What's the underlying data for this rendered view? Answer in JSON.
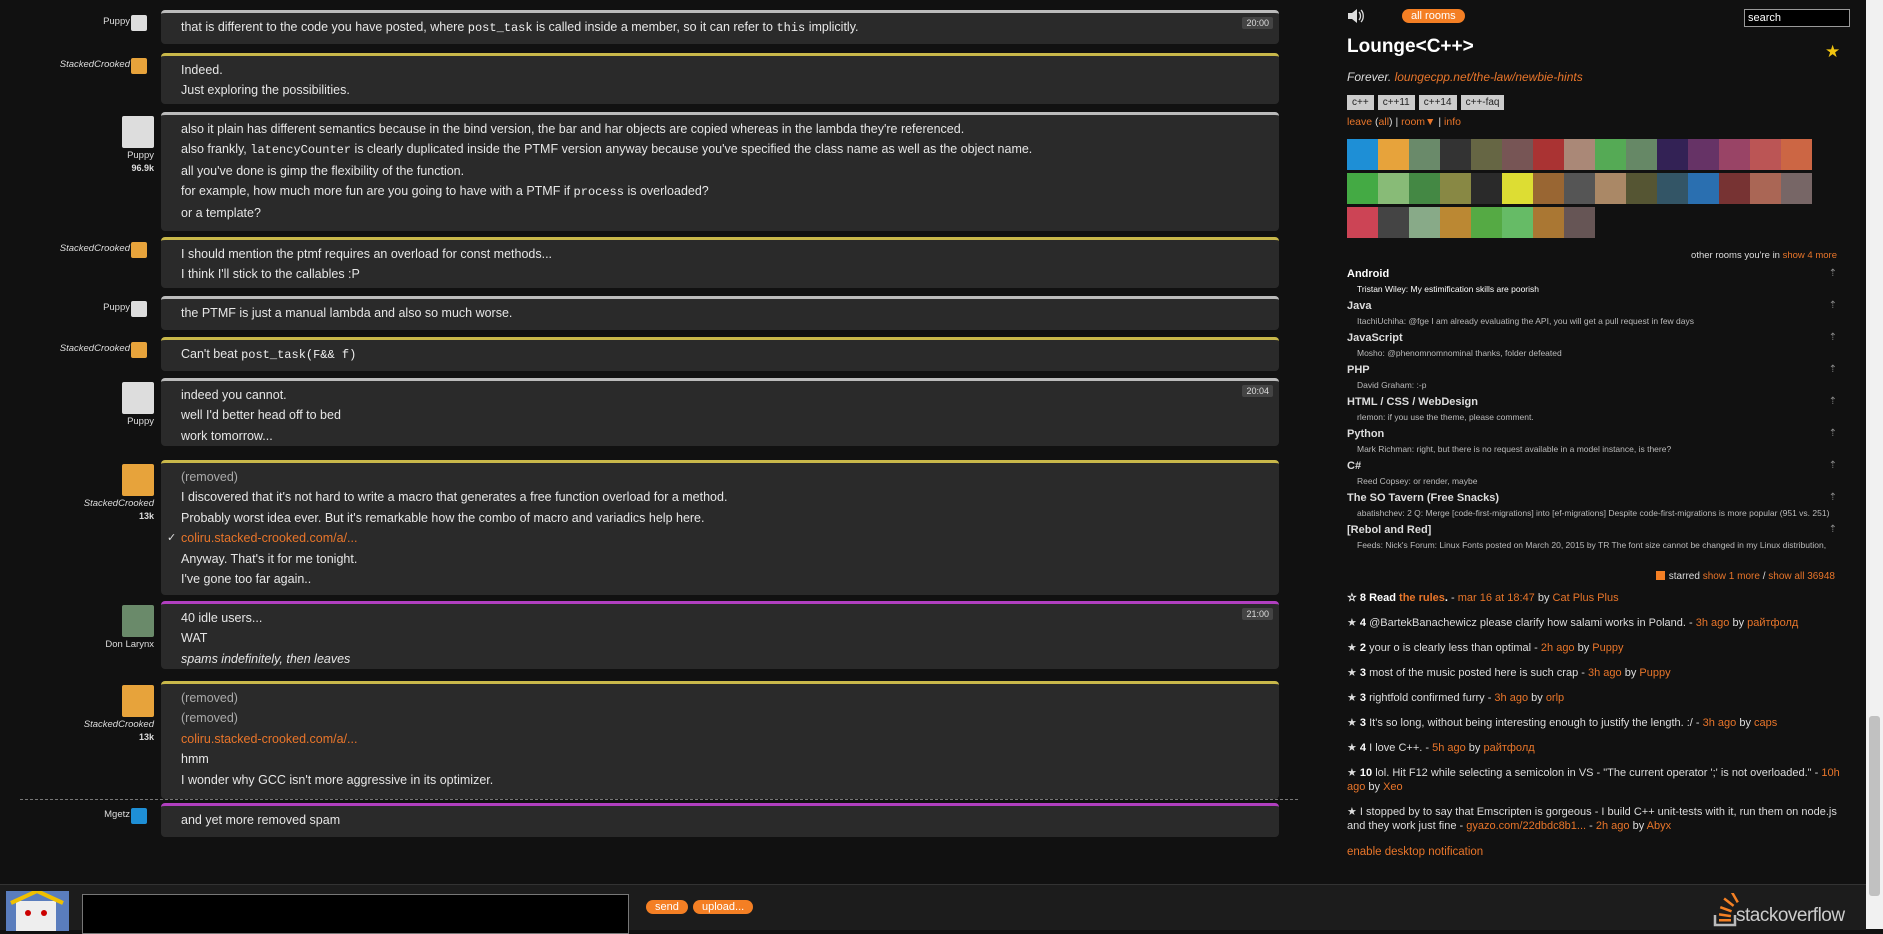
{
  "messages": [
    {
      "user": "Puppy",
      "avatar_color": "#ddd",
      "style": "small",
      "border": "w",
      "lines": [
        {
          "html": "that is different to the code you have posted, where <code>post_task</code> is called inside a member, so it can refer to <code>this</code> implicitly."
        }
      ],
      "time": "20:00"
    },
    {
      "user": "StackedCrooked",
      "avatar_color": "#e7a33b",
      "style": "small",
      "italic": true,
      "border": "y",
      "lines": [
        {
          "text": "Indeed."
        },
        {
          "text": "Just exploring the possibilities."
        }
      ]
    },
    {
      "user": "Puppy",
      "rep": "96.9k",
      "avatar_color": "#ddd",
      "style": "big",
      "border": "w",
      "lines": [
        {
          "text": "also it plain has different semantics because in the bind version, the bar and har objects are copied whereas in the lambda they're referenced."
        },
        {
          "html": "also frankly, <code>latencyCounter</code> is clearly duplicated inside the PTMF version anyway because you've specified the class name as well as the object name."
        },
        {
          "text": "all you've done is gimp the flexibility of the function."
        },
        {
          "html": "for example, how much more fun are you going to have with a PTMF if <code>process</code> is overloaded?"
        },
        {
          "text": "or a template?"
        }
      ]
    },
    {
      "user": "StackedCrooked",
      "avatar_color": "#e7a33b",
      "style": "small",
      "italic": true,
      "border": "y",
      "lines": [
        {
          "text": "I should mention the ptmf requires an overload for const methods..."
        },
        {
          "text": "I think I'll stick to the callables :P"
        }
      ]
    },
    {
      "user": "Puppy",
      "avatar_color": "#ddd",
      "style": "small",
      "border": "w",
      "lines": [
        {
          "text": "the PTMF is just a manual lambda and also so much worse."
        }
      ]
    },
    {
      "user": "StackedCrooked",
      "avatar_color": "#e7a33b",
      "style": "small",
      "italic": true,
      "border": "y",
      "lines": [
        {
          "html": "Can't beat <code>post_task(F&amp;&amp; f)</code>"
        }
      ]
    },
    {
      "user": "Puppy",
      "avatar_color": "#ddd",
      "style": "big",
      "border": "w",
      "lines": [
        {
          "text": "indeed you cannot."
        },
        {
          "text": "well I'd better head off to bed"
        },
        {
          "text": "work tomorrow..."
        }
      ],
      "time": "20:04"
    },
    {
      "user": "StackedCrooked",
      "rep": "13k",
      "avatar_color": "#e7a33b",
      "style": "big",
      "italic": true,
      "border": "y",
      "lines": [
        {
          "text": "(removed)",
          "rem": true
        },
        {
          "text": "I discovered that it's not hard to write a macro that generates a free function overload for a method."
        },
        {
          "text": "Probably worst idea ever. But it's remarkable how the combo of macro and variadics help here."
        },
        {
          "link": "coliru.stacked-crooked.com/a/...",
          "check": true
        },
        {
          "text": "Anyway. That's it for me tonight."
        },
        {
          "text": "I've gone too far again.."
        }
      ]
    },
    {
      "user": "Don Larynx",
      "avatar_color": "#6a8a6a",
      "style": "big",
      "border": "p",
      "lines": [
        {
          "text": "40 idle users..."
        },
        {
          "text": "WAT"
        },
        {
          "html": "<i>spams indefinitely, then leaves</i>"
        }
      ],
      "time": "21:00"
    },
    {
      "user": "StackedCrooked",
      "rep": "13k",
      "avatar_color": "#e7a33b",
      "style": "big",
      "italic": true,
      "border": "y",
      "lines": [
        {
          "text": "(removed)",
          "rem": true
        },
        {
          "text": "(removed)",
          "rem": true
        },
        {
          "link": "coliru.stacked-crooked.com/a/..."
        },
        {
          "text": "hmm"
        },
        {
          "text": "I wonder why GCC isn't more aggressive in its optimizer."
        }
      ]
    },
    {
      "user": "Mgetz",
      "avatar_color": "#1e8fd6",
      "style": "small",
      "border": "p",
      "lines": [
        {
          "text": "and yet more removed spam"
        }
      ]
    }
  ],
  "sidebar": {
    "all_rooms": "all rooms",
    "search_value": "search",
    "room_title": "Lounge<C++>",
    "desc_prefix": "Forever.",
    "desc_link": "loungecpp.net/the-law/newbie-hints",
    "tags": [
      "c++",
      "c++11",
      "c++14",
      "c++-faq"
    ],
    "leave": "leave",
    "all": "all",
    "room": "room",
    "info": "info",
    "other_rooms": "other rooms you're in",
    "show_more": "show 4 more",
    "rooms": [
      {
        "name": "Android",
        "msg": "Tristan Wiley: My estimification skills are poorish",
        "bright": true
      },
      {
        "name": "Java",
        "msg": "ItachiUchiha: @fge I am already evaluating the API, you will get a pull request in few days"
      },
      {
        "name": "JavaScript",
        "msg": "Mosho: @phenomnomnominal thanks, folder defeated"
      },
      {
        "name": "PHP",
        "msg": "David Graham: :-p"
      },
      {
        "name": "HTML / CSS / WebDesign",
        "msg": "rlemon: if you use the theme, please comment."
      },
      {
        "name": "Python",
        "msg": "Mark Richman: right, but there is no request available in a model instance, is there?"
      },
      {
        "name": "C#",
        "msg": "Reed Copsey: or render, maybe"
      },
      {
        "name": "The SO Tavern (Free Snacks)",
        "msg": "abatishchev: 2 Q: Merge [code-first-migrations] into [ef-migrations] Despite code-first-migrations is more popular (951 vs. 251)"
      },
      {
        "name": "[Rebol and Red]",
        "msg": "Feeds: Nick's Forum: Linux Fonts posted on March 20, 2015 by TR The font size cannot be changed in my Linux distribution,"
      }
    ],
    "starred_label": "starred",
    "show_1_more": "show 1 more",
    "show_all": "show all 36948",
    "starred": [
      {
        "html": "<b>☆ 8 Read <a>the rules</a>.</b> - <a>mar 16 at 18:47</a> by <a>Cat Plus Plus</a>"
      },
      {
        "html": "★ <b>4</b> @BartekBanachewicz please clarify how salami works in Poland. - <a>3h ago</a> by <a>райтфолд</a>"
      },
      {
        "html": "★ <b>2</b> your o is clearly less than optimal - <a>2h ago</a> by <a>Puppy</a>"
      },
      {
        "html": "★ <b>3</b> most of the music posted here is such crap - <a>3h ago</a> by <a>Puppy</a>"
      },
      {
        "html": "★ <b>3</b> rightfold confirmed furry - <a>3h ago</a> by <a>orlp</a>"
      },
      {
        "html": "★ <b>3</b> It's so long, without being interesting enough to justify the length. :/ - <a>3h ago</a> by <a>caps</a>"
      },
      {
        "html": "★ <b>4</b> I love C++. - <a>5h ago</a> by <a>райтфолд</a>"
      },
      {
        "html": "★ <b>10</b> lol. Hit F12 while selecting a semicolon in VS - \"The current operator ';' is not overloaded.\" - <a>10h ago</a> by <a>Xeo</a>"
      },
      {
        "html": "★ I stopped by to say that Emscripten is gorgeous - I build C++ unit-tests with it, run them on node.js and they work just fine - <a>gyazo.com/22dbdc8b1...</a> - <a>2h ago</a> by <a>Abyx</a>"
      }
    ],
    "desktop_notif": "enable desktop notification"
  },
  "bottom": {
    "send": "send",
    "upload": "upload...",
    "logo": "stackoverflow"
  }
}
